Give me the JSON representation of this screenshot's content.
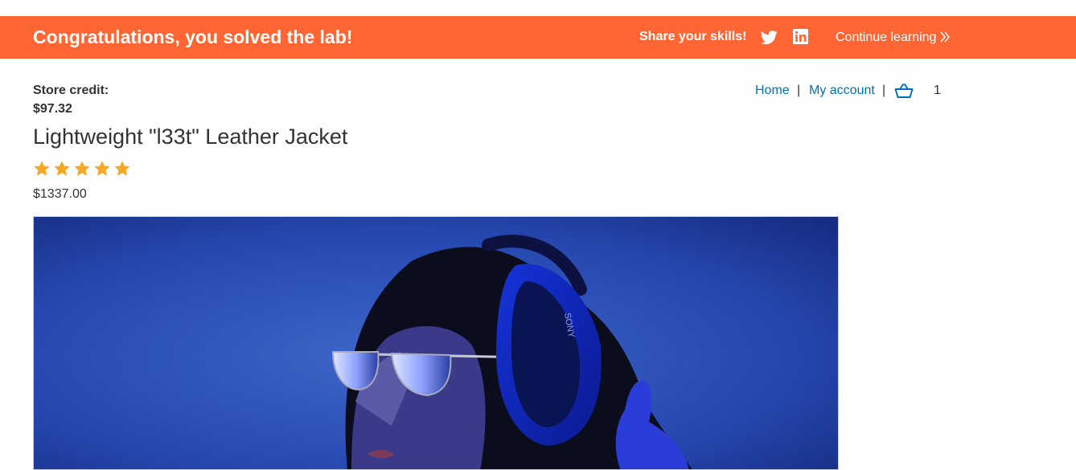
{
  "banner": {
    "message": "Congratulations, you solved the lab!",
    "share_label": "Share your skills!",
    "twitter_icon": "twitter-icon",
    "linkedin_icon": "linkedin-icon",
    "continue_label": "Continue learning",
    "continue_icon": "double-chevron-right-icon",
    "background_color": "#ff6633"
  },
  "account": {
    "store_credit_label": "Store credit:",
    "store_credit_value": "$97.32"
  },
  "nav": {
    "home": "Home",
    "separator": "|",
    "my_account": "My account",
    "cart_icon": "shopping-basket-icon",
    "cart_count": "1",
    "link_color": "#0071bc"
  },
  "product": {
    "title": "Lightweight \"l33t\" Leather Jacket",
    "rating": 5,
    "rating_max": 5,
    "star_color": "#f9a825",
    "price": "$1337.00",
    "image_description_icon": "product-photo"
  }
}
